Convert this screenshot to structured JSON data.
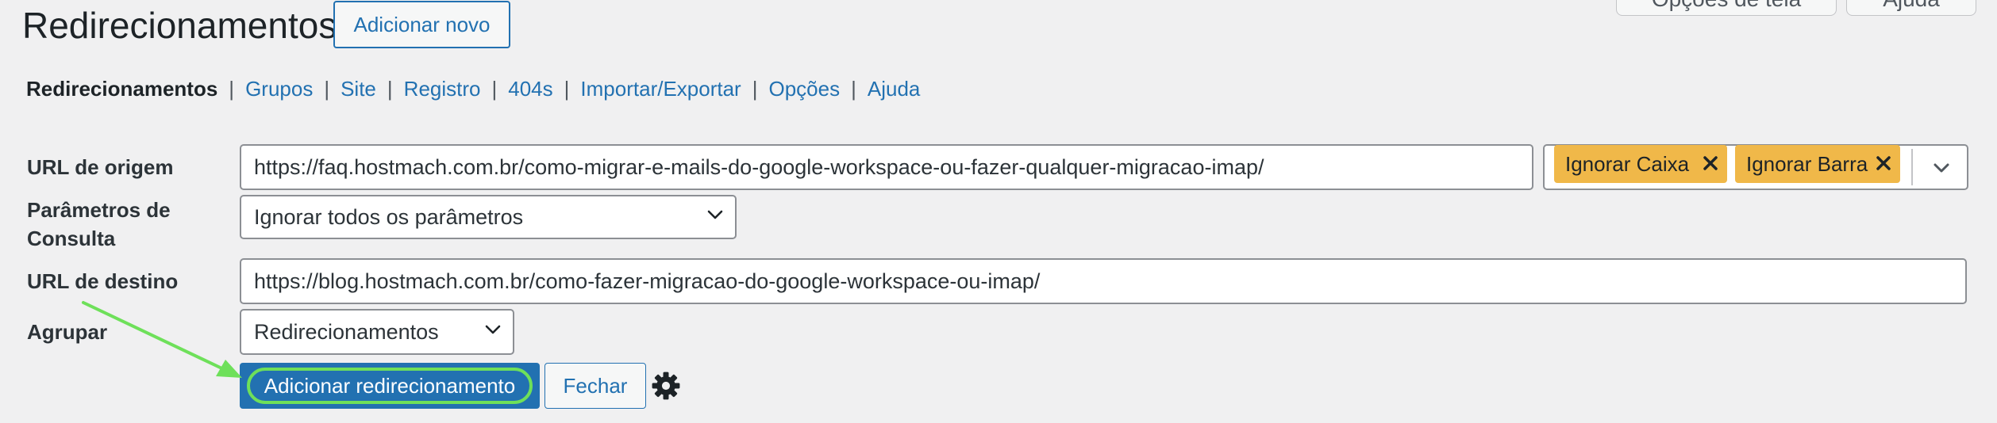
{
  "header": {
    "title": "Redirecionamentos",
    "add_new_label": "Adicionar novo",
    "screen_tabs": [
      "Opções de tela",
      "Ajuda"
    ]
  },
  "subnav": {
    "items": [
      {
        "label": "Redirecionamentos",
        "current": true
      },
      {
        "label": "Grupos"
      },
      {
        "label": "Site"
      },
      {
        "label": "Registro"
      },
      {
        "label": "404s"
      },
      {
        "label": "Importar/Exportar"
      },
      {
        "label": "Opções"
      },
      {
        "label": "Ajuda"
      }
    ],
    "separator": "|"
  },
  "form": {
    "source_url": {
      "label": "URL de origem",
      "value": "https://faq.hostmach.com.br/como-migrar-e-mails-do-google-workspace-ou-fazer-qualquer-migracao-imap/"
    },
    "url_options": {
      "tags": [
        "Ignorar Caixa",
        "Ignorar Barra"
      ]
    },
    "query_params": {
      "label": "Parâmetros de Consulta",
      "label_line1": "Parâmetros de",
      "label_line2": "Consulta",
      "value": "Ignorar todos os parâmetros"
    },
    "target_url": {
      "label": "URL de destino",
      "value": "https://blog.hostmach.com.br/como-fazer-migracao-do-google-workspace-ou-imap/"
    },
    "group": {
      "label": "Agrupar",
      "value": "Redirecionamentos"
    },
    "actions": {
      "add_label": "Adicionar redirecionamento",
      "close_label": "Fechar"
    }
  },
  "colors": {
    "primary": "#2271b1",
    "tag": "#f0b849",
    "annotation": "#6ee05a",
    "background": "#f0f0f1"
  },
  "icons": [
    "chevron-down-icon",
    "close-icon",
    "gear-icon",
    "arrow-annotation"
  ]
}
